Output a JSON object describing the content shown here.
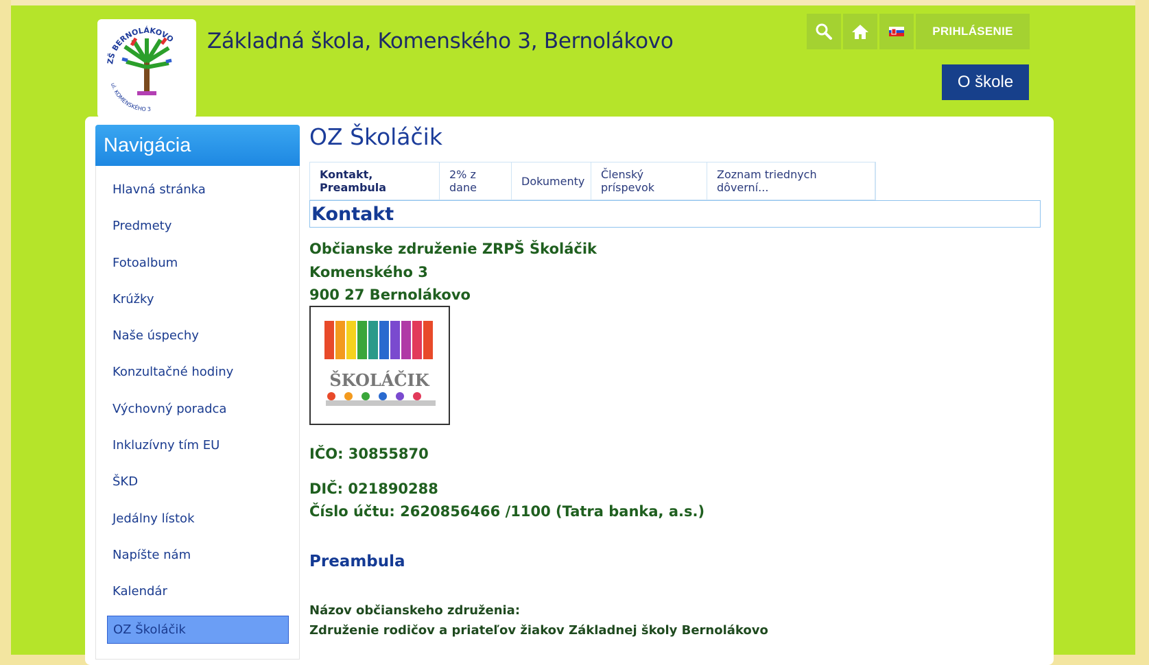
{
  "header": {
    "site_title": "Základná škola, Komenského 3, Bernolákovo",
    "logo_text_top": "ZŠ BERNOLÁKOVO",
    "logo_text_bottom": "ul. KOMENSKÉHO 3",
    "login_label": "PRIHLÁSENIE",
    "about_label": "O škole",
    "icons": [
      "search-icon",
      "home-icon",
      "flag-icon"
    ]
  },
  "nav": {
    "heading": "Navigácia",
    "items": [
      {
        "label": "Hlavná stránka"
      },
      {
        "label": "Predmety"
      },
      {
        "label": "Fotoalbum"
      },
      {
        "label": "Krúžky"
      },
      {
        "label": "Naše úspechy"
      },
      {
        "label": "Konzultačné hodiny"
      },
      {
        "label": "Výchovný poradca"
      },
      {
        "label": "Inkluzívny tím EU"
      },
      {
        "label": "ŠKD"
      },
      {
        "label": "Jedálny lístok"
      },
      {
        "label": "Napíšte nám"
      },
      {
        "label": "Kalendár"
      }
    ],
    "active_item": "OZ Školáčik"
  },
  "content": {
    "page_title": "OZ Školáčik",
    "tabs": [
      {
        "label": "Kontakt, Preambula",
        "active": true
      },
      {
        "label": "2% z dane",
        "active": false
      },
      {
        "label": "Dokumenty",
        "active": false
      },
      {
        "label": "Členský príspevok",
        "active": false
      },
      {
        "label": "Zoznam triednych dôverní...",
        "active": false
      }
    ],
    "section_heading": "Kontakt",
    "org_name": "Občianske združenie ZRPŠ Školáčik",
    "street": "Komenského 3",
    "city": "900 27 Bernolákovo",
    "logo_text": "ŠKOLÁČIK",
    "ico": "IČO: 30855870",
    "dic": "DIČ: 021890288",
    "account": "Číslo účtu: 2620856466 /1100 (Tatra banka, a.s.)",
    "preamble_heading": "Preambula",
    "preamble_label": "Názov občianskeho združenia:",
    "preamble_value": "Združenie rodičov a priateľov žiakov Základnej školy Bernolákovo"
  },
  "colors": {
    "page_bg": "#b5e42a",
    "nav_head": "#1e88e2",
    "accent_button": "#17408b",
    "text_green": "#1f5f1f",
    "link_blue": "#1a3b8f"
  }
}
